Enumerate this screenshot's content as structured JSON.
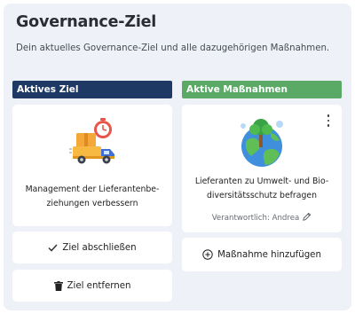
{
  "header": {
    "title": "Governance-Ziel",
    "subtitle": "Dein aktuelles Governance-Ziel und alle dazugehörigen Maßnahmen."
  },
  "columns": {
    "goal_label": "Aktives Ziel",
    "measures_label": "Aktive Maßnahmen"
  },
  "goal": {
    "text_line1": "Management der Lieferantenbe-",
    "text_line2": "ziehungen verbessern",
    "icon": "delivery-truck-clock-illustration"
  },
  "measure": {
    "text_line1": "Lieferanten zu Umwelt- und Bio-",
    "text_line2": "diversitätsschutz befragen",
    "responsible": "Verantwortlich: Andrea",
    "icon": "earth-tree-illustration"
  },
  "buttons": {
    "complete_goal": "Ziel abschließen",
    "remove_goal": "Ziel entfernen",
    "add_measure": "Maßnahme hinzufügen"
  },
  "colors": {
    "goal_header": "#1e3a64",
    "measures_header": "#5aaa65",
    "panel_background": "#eef1f7"
  }
}
